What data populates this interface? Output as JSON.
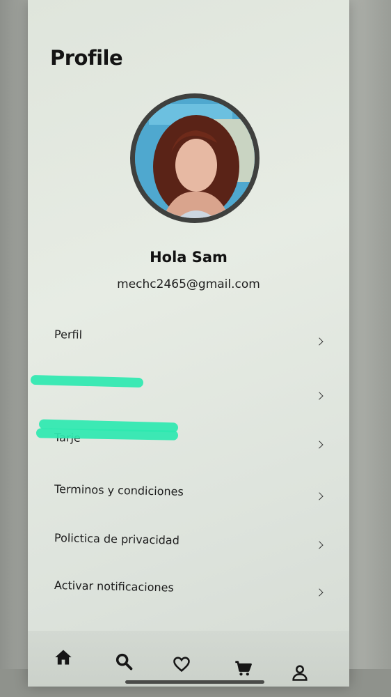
{
  "header": {
    "title": "Profile"
  },
  "user": {
    "greeting": "Hola Sam",
    "email": "mechc2465@gmail.com"
  },
  "menu": {
    "items": [
      {
        "label": "Perfil"
      },
      {
        "label": ""
      },
      {
        "label": "Tarje"
      },
      {
        "label": "Terminos y condiciones"
      },
      {
        "label": "Polictica de privacidad"
      },
      {
        "label": "Activar notificaciones"
      }
    ]
  },
  "bottom_nav": {
    "items": [
      {
        "icon": "home-icon"
      },
      {
        "icon": "search-icon"
      },
      {
        "icon": "heart-icon"
      },
      {
        "icon": "cart-icon"
      },
      {
        "icon": "user-icon"
      }
    ]
  },
  "colors": {
    "redaction": "#2ee8b0",
    "text": "#1c1c1c"
  }
}
